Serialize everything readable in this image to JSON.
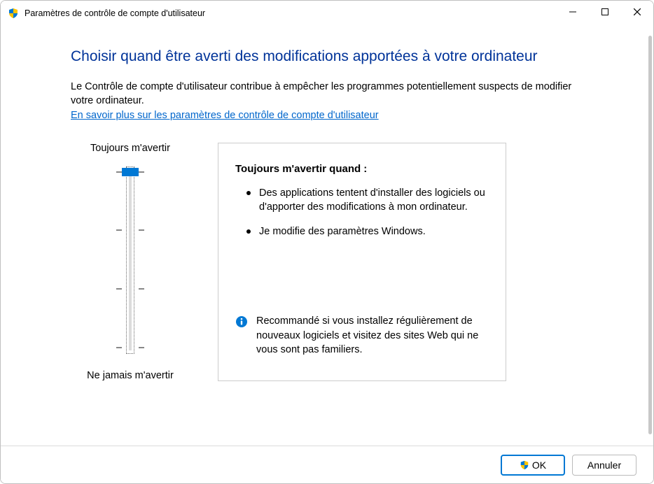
{
  "window": {
    "title": "Paramètres de contrôle de compte d'utilisateur"
  },
  "heading": "Choisir quand être averti des modifications apportées à votre ordinateur",
  "intro": "Le Contrôle de compte d'utilisateur contribue à empêcher les programmes potentiellement suspects de modifier votre ordinateur.",
  "learn_more": "En savoir plus sur les paramètres de contrôle de compte d'utilisateur",
  "slider": {
    "top_label": "Toujours m'avertir",
    "bottom_label": "Ne jamais m'avertir",
    "level": 0,
    "levels": 4
  },
  "detail": {
    "title": "Toujours m'avertir quand :",
    "bullets": [
      "Des applications tentent d'installer des logiciels ou d'apporter des modifications à mon ordinateur.",
      "Je modifie des paramètres Windows."
    ],
    "recommendation": "Recommandé si vous installez régulièrement de nouveaux logiciels et visitez des sites Web qui ne vous sont pas familiers."
  },
  "buttons": {
    "ok": "OK",
    "cancel": "Annuler"
  }
}
